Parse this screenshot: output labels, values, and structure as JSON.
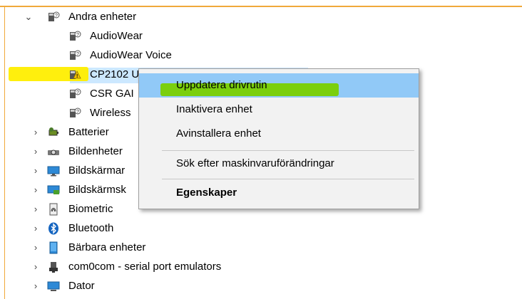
{
  "tree": {
    "other_devices": {
      "label": "Andra enheter",
      "children": [
        {
          "label": "AudioWear"
        },
        {
          "label": "AudioWear Voice"
        },
        {
          "label": "CP2102 U"
        },
        {
          "label": "CSR GAI"
        },
        {
          "label": "Wireless"
        }
      ]
    },
    "categories": [
      {
        "label": "Batterier",
        "icon": "battery-icon"
      },
      {
        "label": "Bildenheter",
        "icon": "camera-icon"
      },
      {
        "label": "Bildskärmar",
        "icon": "monitor-icon"
      },
      {
        "label": "Bildskärmsk",
        "icon": "display-adapter-icon"
      },
      {
        "label": "Biometric",
        "icon": "fingerprint-icon"
      },
      {
        "label": "Bluetooth",
        "icon": "bluetooth-icon"
      },
      {
        "label": "Bärbara enheter",
        "icon": "portable-device-icon"
      },
      {
        "label": "com0com - serial port emulators",
        "icon": "port-icon"
      },
      {
        "label": "Dator",
        "icon": "computer-icon"
      }
    ]
  },
  "context_menu": {
    "update_driver": "Uppdatera drivrutin",
    "disable_device": "Inaktivera enhet",
    "uninstall_device": "Avinstallera enhet",
    "scan_hardware": "Sök efter maskinvaruförändringar",
    "properties": "Egenskaper"
  },
  "colors": {
    "accent_frame": "#f0a93a",
    "menu_hover": "#91c9f7",
    "yellow_marker": "#ffee00",
    "green_marker": "#7ad000"
  }
}
